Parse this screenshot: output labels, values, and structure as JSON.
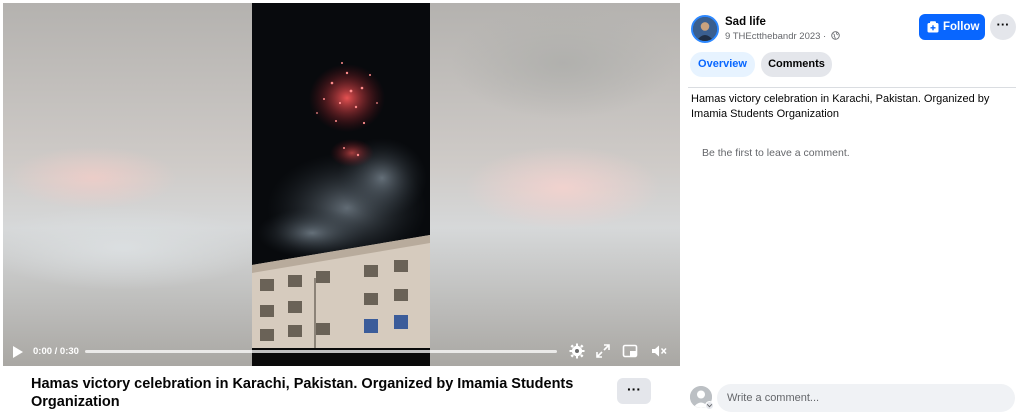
{
  "video": {
    "time": "0:00 / 0:30",
    "progress": 0,
    "controls": [
      "play-icon",
      "gear-icon",
      "fullscreen-icon",
      "picture-in-picture-icon",
      "volume-muted-icon"
    ]
  },
  "title": "Hamas victory celebration in Karachi, Pakistan. Organized by Imamia Students Organization",
  "title_more_label": "···",
  "author": {
    "name": "Sad life",
    "meta": "9 THEctthebandr 2023 ·",
    "privacy_icon": "globe-icon"
  },
  "buttons": {
    "follow": "Follow",
    "more": "···"
  },
  "tabs": {
    "overview": "Overview",
    "comments": "Comments"
  },
  "description": "Hamas victory celebration in Karachi, Pakistan. Organized by Imamia Students Organization",
  "comments": {
    "empty_text": "Be the first to leave a comment.",
    "input_placeholder": "Write a comment..."
  },
  "colors": {
    "accent": "#0866ff",
    "tab_active_bg": "#e7f3ff",
    "secondary_button": "#e4e6eb"
  }
}
